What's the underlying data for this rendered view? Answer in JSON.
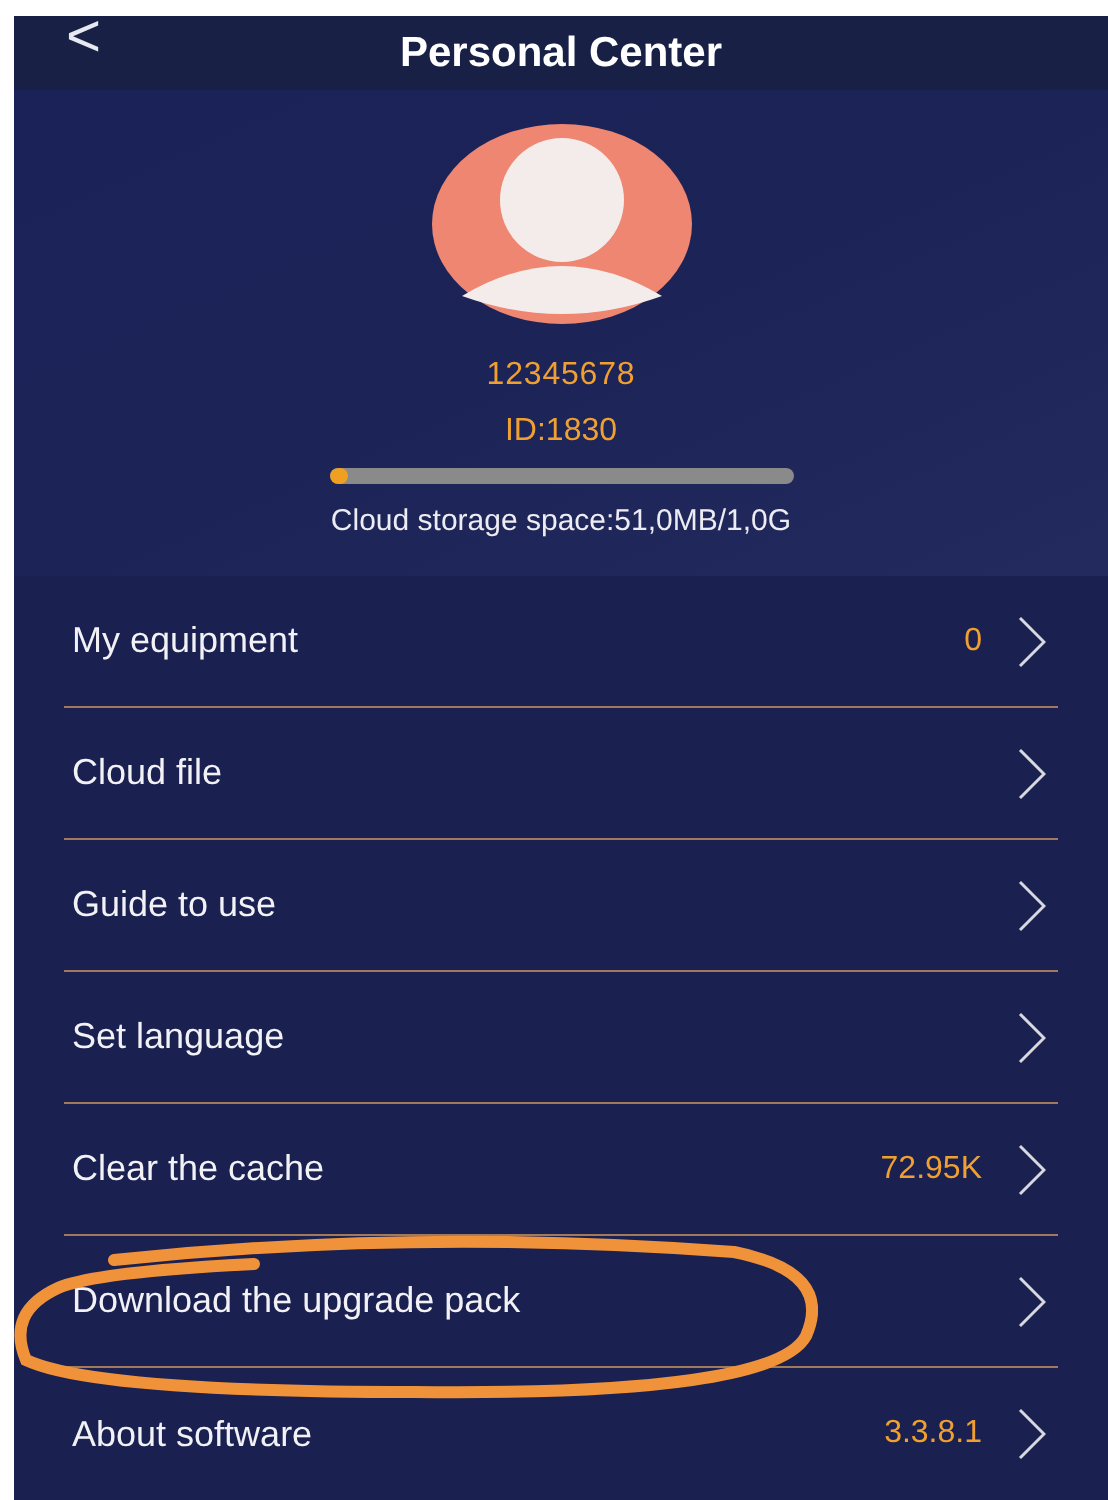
{
  "header": {
    "back": "<",
    "title": "Personal Center"
  },
  "profile": {
    "username": "12345678",
    "user_id": "ID:1830",
    "storage": {
      "level": 0.04,
      "label": "Cloud storage space:51,0MB/1,0G"
    }
  },
  "menu": [
    {
      "label": "My equipment",
      "value": "0"
    },
    {
      "label": "Cloud file"
    },
    {
      "label": "Guide to use"
    },
    {
      "label": "Set language"
    },
    {
      "label": "Clear the cache",
      "value": "72.95K"
    },
    {
      "label": "Download the upgrade pack"
    },
    {
      "label": "About software",
      "value": "3.3.8.1"
    }
  ]
}
